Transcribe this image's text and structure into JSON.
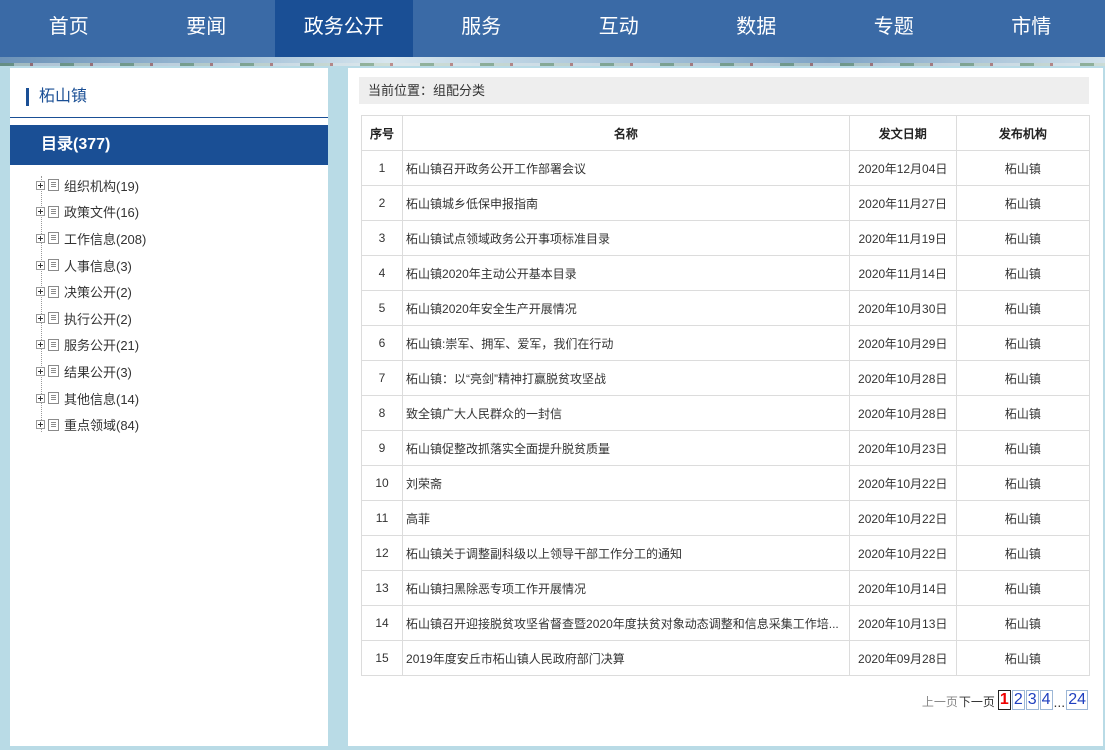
{
  "nav": {
    "items": [
      "首页",
      "要闻",
      "政务公开",
      "服务",
      "互动",
      "数据",
      "专题",
      "市情"
    ],
    "active_index": 2
  },
  "sidebar": {
    "title": "柘山镇",
    "catalog": "目录(377)",
    "tree": [
      "组织机构(19)",
      "政策文件(16)",
      "工作信息(208)",
      "人事信息(3)",
      "决策公开(2)",
      "执行公开(2)",
      "服务公开(21)",
      "结果公开(3)",
      "其他信息(14)",
      "重点领域(84)"
    ]
  },
  "breadcrumb": "当前位置：组配分类",
  "table": {
    "headers": [
      "序号",
      "名称",
      "发文日期",
      "发布机构"
    ],
    "rows": [
      {
        "no": "1",
        "name": "柘山镇召开政务公开工作部署会议",
        "date": "2020年12月04日",
        "org": "柘山镇"
      },
      {
        "no": "2",
        "name": "柘山镇城乡低保申报指南",
        "date": "2020年11月27日",
        "org": "柘山镇"
      },
      {
        "no": "3",
        "name": "柘山镇试点领域政务公开事项标准目录",
        "date": "2020年11月19日",
        "org": "柘山镇"
      },
      {
        "no": "4",
        "name": "柘山镇2020年主动公开基本目录",
        "date": "2020年11月14日",
        "org": "柘山镇"
      },
      {
        "no": "5",
        "name": "柘山镇2020年安全生产开展情况",
        "date": "2020年10月30日",
        "org": "柘山镇"
      },
      {
        "no": "6",
        "name": "柘山镇:崇军、拥军、爱军，我们在行动",
        "date": "2020年10月29日",
        "org": "柘山镇"
      },
      {
        "no": "7",
        "name": "柘山镇：以“亮剑”精神打赢脱贫攻坚战",
        "date": "2020年10月28日",
        "org": "柘山镇"
      },
      {
        "no": "8",
        "name": "致全镇广大人民群众的一封信",
        "date": "2020年10月28日",
        "org": "柘山镇"
      },
      {
        "no": "9",
        "name": "柘山镇促整改抓落实全面提升脱贫质量",
        "date": "2020年10月23日",
        "org": "柘山镇"
      },
      {
        "no": "10",
        "name": "刘荣斋",
        "date": "2020年10月22日",
        "org": "柘山镇"
      },
      {
        "no": "11",
        "name": "高菲",
        "date": "2020年10月22日",
        "org": "柘山镇"
      },
      {
        "no": "12",
        "name": "柘山镇关于调整副科级以上领导干部工作分工的通知",
        "date": "2020年10月22日",
        "org": "柘山镇"
      },
      {
        "no": "13",
        "name": "柘山镇扫黑除恶专项工作开展情况",
        "date": "2020年10月14日",
        "org": "柘山镇"
      },
      {
        "no": "14",
        "name": "柘山镇召开迎接脱贫攻坚省督查暨2020年度扶贫对象动态调整和信息采集工作培...",
        "date": "2020年10月13日",
        "org": "柘山镇"
      },
      {
        "no": "15",
        "name": "2019年度安丘市柘山镇人民政府部门决算",
        "date": "2020年09月28日",
        "org": "柘山镇"
      }
    ]
  },
  "pager": {
    "prev": "上一页",
    "next": "下一页",
    "pages": [
      "1",
      "2",
      "3",
      "4"
    ],
    "current": "1",
    "ellipsis": "...",
    "last": "24"
  },
  "colors": {
    "nav_bg": "#3a6aa6",
    "nav_active": "#1a4f95",
    "page_bg": "#b9dbe6",
    "pager_current": "#ee0000"
  }
}
